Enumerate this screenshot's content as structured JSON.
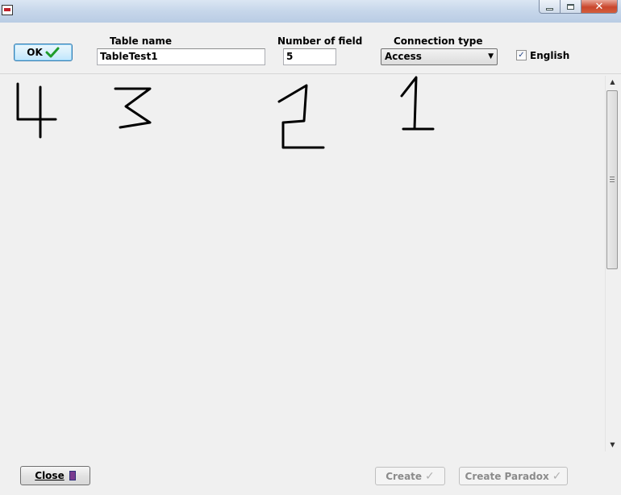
{
  "window": {
    "title": "",
    "close_glyph": "✕"
  },
  "toolbar": {
    "ok_label": "OK",
    "ok_icon": "green-checkmark-icon",
    "table_name_label": "Table name",
    "table_name_value": "TableTest1",
    "number_of_field_label": "Number of field",
    "number_of_field_value": "5",
    "connection_type_label": "Connection type",
    "connection_type_selected": "Access",
    "english_label": "English",
    "english_checked": true
  },
  "canvas": {
    "handwritten_digits": [
      "4",
      "3",
      "2",
      "1"
    ]
  },
  "footer": {
    "close_label": "Close",
    "create_label": "Create",
    "create_paradox_label": "Create Paradox"
  },
  "colors": {
    "ok_check": "#1e9c2b",
    "close_button_red": "#c9462c",
    "ink": "#000000"
  }
}
